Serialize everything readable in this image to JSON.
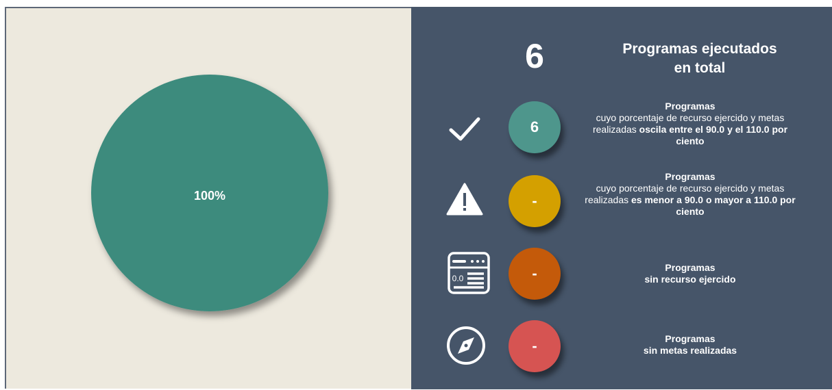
{
  "chart_data": {
    "type": "pie",
    "slices": [
      {
        "label": "100%",
        "value": 100,
        "color": "#3d8b7d"
      }
    ]
  },
  "summary": {
    "total": "6",
    "title_line1": "Programas ejecutados",
    "title_line2": "en total"
  },
  "rows": [
    {
      "icon": "check-icon",
      "count": "6",
      "color": "#4e968c",
      "heading": "Programas",
      "text_normal": "cuyo porcentaje de recurso ejercido y metas realizadas ",
      "text_bold": "oscila entre el 90.0 y el 110.0 por ciento"
    },
    {
      "icon": "warning-icon",
      "count": "-",
      "color": "#d4a000",
      "heading": "Programas",
      "text_normal": "cuyo porcentaje de recurso ejercido y metas realizadas ",
      "text_bold": "es menor a 90.0 o mayor a 110.0 por ciento"
    },
    {
      "icon": "budget-window-icon",
      "icon_label": "0.0",
      "count": "-",
      "color": "#c45a0a",
      "heading": "Programas",
      "text_bold": "sin recurso ejercido"
    },
    {
      "icon": "compass-icon",
      "count": "-",
      "color": "#d65452",
      "heading": "Programas",
      "text_bold": "sin metas realizadas"
    }
  ]
}
